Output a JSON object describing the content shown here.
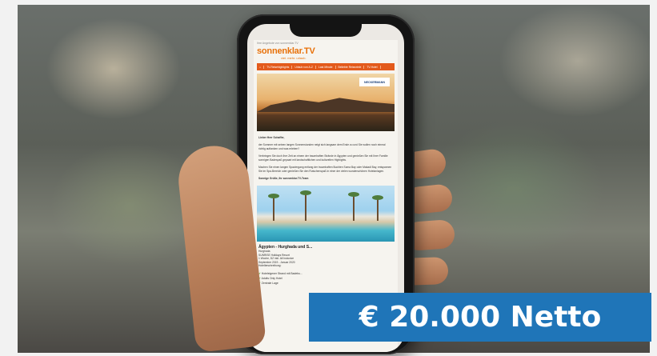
{
  "email": {
    "view_online": "Ihre Angebote von sonnenklar.TV",
    "brand_name": "sonnenklar.TV",
    "brand_tagline": "viel. mehr. urlaub.",
    "nav": [
      "TV-Reisehighlights",
      "Urlaub von A-Z",
      "Last Minute",
      "Beliebte Reiseziele",
      "TV-Hotel"
    ],
    "partner_logo": "NECKERMANN",
    "greeting": "Lieber Herr Schaffer,",
    "paragraphs": [
      "der Sommer mit seinen langen Sonnenstunden neigt sich langsam dem Ende zu und Sie wollen noch einmal richtig auftanken und was erleben?",
      "Verbringen Sie doch Ihre Zeit an einem der traumhaften Strände in Ägypten und genießen Sie mit Ihrer Familie sonnigen Badespaß gepaart mit landschaftlichen und kulturellen Highlights.",
      "Machen Sie einen langen Spaziergang entlang der traumhaften Buchten Soma Bay oder Makadi Bay, entspannen Sie im Spa-Bereich oder genießen Sie den Rutschenspaß in einer der vielen wunderschönen Hotelanlagen.",
      "Sonnige Grüße, Ihr sonnenklar.TV-Team"
    ],
    "offer_title": "Ägypten - Hurghada und S...",
    "offer_lines": [
      "Hurghada",
      "SUNRISE Holidays Resort",
      "1 Woche, DZ inkl. All Inclusive",
      "September 2019 - Januar 2020",
      "Hotelbeschreibung:"
    ],
    "features": [
      "Hoteleigener Strand mit Badebu...",
      "Adults Only Hotel",
      "Zentrale Lage"
    ]
  },
  "price_badge": "€ 20.000 Netto"
}
